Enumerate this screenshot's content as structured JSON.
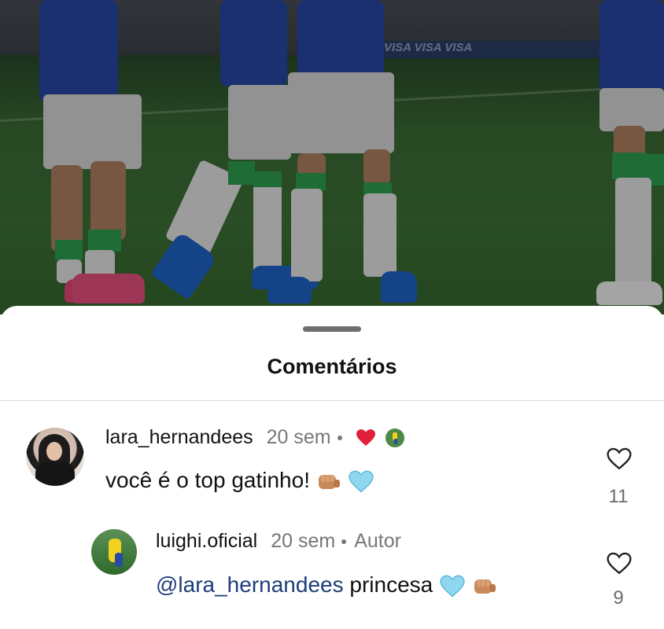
{
  "sheet": {
    "title": "Comentários"
  },
  "photo": {
    "board_text": "VISA  VISA  VISA"
  },
  "comments": [
    {
      "username": "lara_hernandees",
      "time": "20 sem",
      "text": "você é o top gatinho!",
      "likes": "11"
    }
  ],
  "replies": [
    {
      "username": "luighi.oficial",
      "time": "20 sem",
      "author_badge": "Autor",
      "mention": "@lara_hernandees",
      "text": "princesa",
      "likes": "9"
    }
  ],
  "colors": {
    "heart_red": "#e0203a",
    "mention_blue": "#1d3c7a",
    "light_blue_heart": "#8fd6ef"
  },
  "icons": {
    "like": "heart-outline-icon",
    "liked_by_author": "red-heart-icon",
    "fist": "oncoming-fist-emoji",
    "blue_heart": "light-blue-heart-emoji"
  }
}
